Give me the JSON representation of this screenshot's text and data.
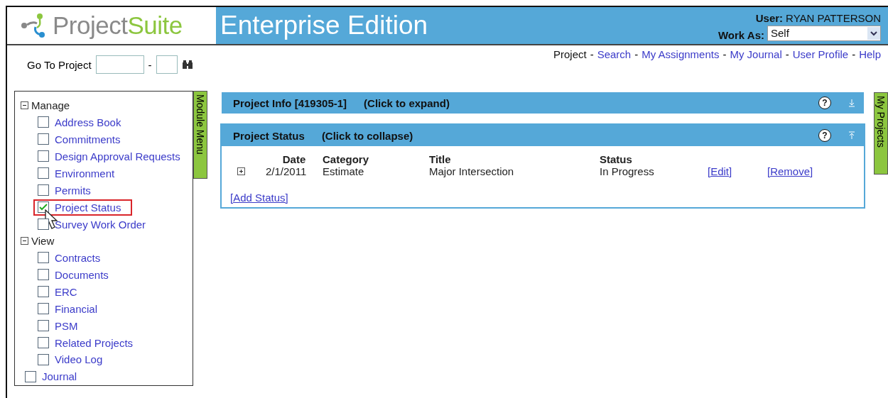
{
  "header": {
    "logo_first": "Project",
    "logo_second": "Suite",
    "edition": "Enterprise Edition",
    "user_label": "User:",
    "user_name": "RYAN PATTERSON",
    "work_as_label": "Work As:",
    "work_as_value": "Self"
  },
  "goto": {
    "label": "Go To Project",
    "separator": "-"
  },
  "nav": [
    {
      "label": "Project",
      "link": false
    },
    {
      "label": "Search",
      "link": true
    },
    {
      "label": "My Assignments",
      "link": true
    },
    {
      "label": "My Journal",
      "link": true
    },
    {
      "label": "User Profile",
      "link": true
    },
    {
      "label": "Help",
      "link": true
    }
  ],
  "nav_separator": "-",
  "sidebar": {
    "tab": "Module Menu",
    "groups": [
      {
        "label": "Manage",
        "expanded": true,
        "items": [
          {
            "label": "Address Book",
            "checked": false,
            "highlighted": false
          },
          {
            "label": "Commitments",
            "checked": false,
            "highlighted": false
          },
          {
            "label": "Design Approval Requests",
            "checked": false,
            "highlighted": false
          },
          {
            "label": "Environment",
            "checked": false,
            "highlighted": false
          },
          {
            "label": "Permits",
            "checked": false,
            "highlighted": false
          },
          {
            "label": "Project Status",
            "checked": true,
            "highlighted": true
          },
          {
            "label": "Survey Work Order",
            "checked": false,
            "highlighted": false
          }
        ]
      },
      {
        "label": "View",
        "expanded": true,
        "items": [
          {
            "label": "Contracts",
            "checked": false,
            "highlighted": false
          },
          {
            "label": "Documents",
            "checked": false,
            "highlighted": false
          },
          {
            "label": "ERC",
            "checked": false,
            "highlighted": false
          },
          {
            "label": "Financial",
            "checked": false,
            "highlighted": false
          },
          {
            "label": "PSM",
            "checked": false,
            "highlighted": false
          },
          {
            "label": "Related Projects",
            "checked": false,
            "highlighted": false
          },
          {
            "label": "Video Log",
            "checked": false,
            "highlighted": false
          }
        ]
      }
    ],
    "extra": [
      {
        "label": "Journal",
        "checked": false
      }
    ]
  },
  "panels": [
    {
      "title": "Project Info [419305-1]",
      "hint": "(Click to expand)",
      "help": "?",
      "expanded": false
    },
    {
      "title": "Project Status",
      "hint": "(Click to collapse)",
      "help": "?",
      "expanded": true,
      "table": {
        "columns": [
          "Date",
          "Category",
          "Title",
          "Status"
        ],
        "rows": [
          {
            "date": "2/1/2011",
            "category": "Estimate",
            "title": "Major Intersection",
            "status": "In Progress",
            "actions": [
              "[Edit]",
              "[Remove]"
            ]
          }
        ]
      },
      "add_link": "[Add Status]"
    }
  ],
  "right_tab": "My Projects"
}
